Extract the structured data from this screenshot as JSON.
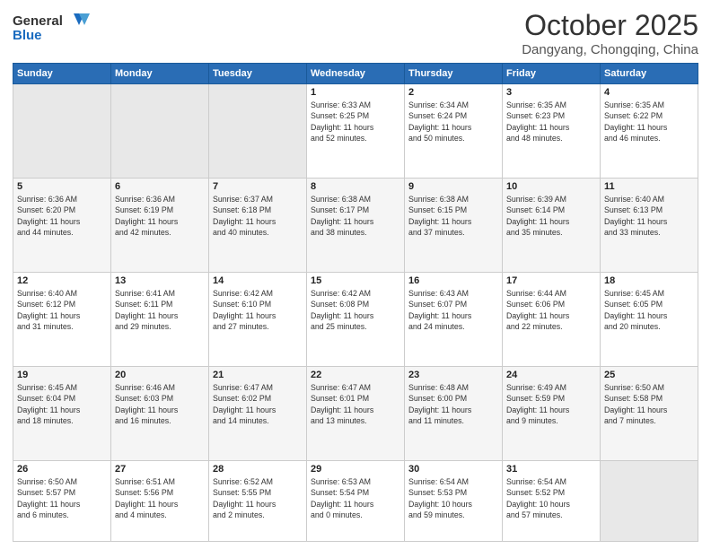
{
  "header": {
    "logo": {
      "general": "General",
      "blue": "Blue"
    },
    "title": "October 2025",
    "location": "Dangyang, Chongqing, China"
  },
  "weekdays": [
    "Sunday",
    "Monday",
    "Tuesday",
    "Wednesday",
    "Thursday",
    "Friday",
    "Saturday"
  ],
  "weeks": [
    {
      "days": [
        {
          "num": "",
          "info": "",
          "empty": true
        },
        {
          "num": "",
          "info": "",
          "empty": true
        },
        {
          "num": "",
          "info": "",
          "empty": true
        },
        {
          "num": "1",
          "info": "Sunrise: 6:33 AM\nSunset: 6:25 PM\nDaylight: 11 hours\nand 52 minutes.",
          "empty": false
        },
        {
          "num": "2",
          "info": "Sunrise: 6:34 AM\nSunset: 6:24 PM\nDaylight: 11 hours\nand 50 minutes.",
          "empty": false
        },
        {
          "num": "3",
          "info": "Sunrise: 6:35 AM\nSunset: 6:23 PM\nDaylight: 11 hours\nand 48 minutes.",
          "empty": false
        },
        {
          "num": "4",
          "info": "Sunrise: 6:35 AM\nSunset: 6:22 PM\nDaylight: 11 hours\nand 46 minutes.",
          "empty": false
        }
      ]
    },
    {
      "days": [
        {
          "num": "5",
          "info": "Sunrise: 6:36 AM\nSunset: 6:20 PM\nDaylight: 11 hours\nand 44 minutes.",
          "empty": false
        },
        {
          "num": "6",
          "info": "Sunrise: 6:36 AM\nSunset: 6:19 PM\nDaylight: 11 hours\nand 42 minutes.",
          "empty": false
        },
        {
          "num": "7",
          "info": "Sunrise: 6:37 AM\nSunset: 6:18 PM\nDaylight: 11 hours\nand 40 minutes.",
          "empty": false
        },
        {
          "num": "8",
          "info": "Sunrise: 6:38 AM\nSunset: 6:17 PM\nDaylight: 11 hours\nand 38 minutes.",
          "empty": false
        },
        {
          "num": "9",
          "info": "Sunrise: 6:38 AM\nSunset: 6:15 PM\nDaylight: 11 hours\nand 37 minutes.",
          "empty": false
        },
        {
          "num": "10",
          "info": "Sunrise: 6:39 AM\nSunset: 6:14 PM\nDaylight: 11 hours\nand 35 minutes.",
          "empty": false
        },
        {
          "num": "11",
          "info": "Sunrise: 6:40 AM\nSunset: 6:13 PM\nDaylight: 11 hours\nand 33 minutes.",
          "empty": false
        }
      ]
    },
    {
      "days": [
        {
          "num": "12",
          "info": "Sunrise: 6:40 AM\nSunset: 6:12 PM\nDaylight: 11 hours\nand 31 minutes.",
          "empty": false
        },
        {
          "num": "13",
          "info": "Sunrise: 6:41 AM\nSunset: 6:11 PM\nDaylight: 11 hours\nand 29 minutes.",
          "empty": false
        },
        {
          "num": "14",
          "info": "Sunrise: 6:42 AM\nSunset: 6:10 PM\nDaylight: 11 hours\nand 27 minutes.",
          "empty": false
        },
        {
          "num": "15",
          "info": "Sunrise: 6:42 AM\nSunset: 6:08 PM\nDaylight: 11 hours\nand 25 minutes.",
          "empty": false
        },
        {
          "num": "16",
          "info": "Sunrise: 6:43 AM\nSunset: 6:07 PM\nDaylight: 11 hours\nand 24 minutes.",
          "empty": false
        },
        {
          "num": "17",
          "info": "Sunrise: 6:44 AM\nSunset: 6:06 PM\nDaylight: 11 hours\nand 22 minutes.",
          "empty": false
        },
        {
          "num": "18",
          "info": "Sunrise: 6:45 AM\nSunset: 6:05 PM\nDaylight: 11 hours\nand 20 minutes.",
          "empty": false
        }
      ]
    },
    {
      "days": [
        {
          "num": "19",
          "info": "Sunrise: 6:45 AM\nSunset: 6:04 PM\nDaylight: 11 hours\nand 18 minutes.",
          "empty": false
        },
        {
          "num": "20",
          "info": "Sunrise: 6:46 AM\nSunset: 6:03 PM\nDaylight: 11 hours\nand 16 minutes.",
          "empty": false
        },
        {
          "num": "21",
          "info": "Sunrise: 6:47 AM\nSunset: 6:02 PM\nDaylight: 11 hours\nand 14 minutes.",
          "empty": false
        },
        {
          "num": "22",
          "info": "Sunrise: 6:47 AM\nSunset: 6:01 PM\nDaylight: 11 hours\nand 13 minutes.",
          "empty": false
        },
        {
          "num": "23",
          "info": "Sunrise: 6:48 AM\nSunset: 6:00 PM\nDaylight: 11 hours\nand 11 minutes.",
          "empty": false
        },
        {
          "num": "24",
          "info": "Sunrise: 6:49 AM\nSunset: 5:59 PM\nDaylight: 11 hours\nand 9 minutes.",
          "empty": false
        },
        {
          "num": "25",
          "info": "Sunrise: 6:50 AM\nSunset: 5:58 PM\nDaylight: 11 hours\nand 7 minutes.",
          "empty": false
        }
      ]
    },
    {
      "days": [
        {
          "num": "26",
          "info": "Sunrise: 6:50 AM\nSunset: 5:57 PM\nDaylight: 11 hours\nand 6 minutes.",
          "empty": false
        },
        {
          "num": "27",
          "info": "Sunrise: 6:51 AM\nSunset: 5:56 PM\nDaylight: 11 hours\nand 4 minutes.",
          "empty": false
        },
        {
          "num": "28",
          "info": "Sunrise: 6:52 AM\nSunset: 5:55 PM\nDaylight: 11 hours\nand 2 minutes.",
          "empty": false
        },
        {
          "num": "29",
          "info": "Sunrise: 6:53 AM\nSunset: 5:54 PM\nDaylight: 11 hours\nand 0 minutes.",
          "empty": false
        },
        {
          "num": "30",
          "info": "Sunrise: 6:54 AM\nSunset: 5:53 PM\nDaylight: 10 hours\nand 59 minutes.",
          "empty": false
        },
        {
          "num": "31",
          "info": "Sunrise: 6:54 AM\nSunset: 5:52 PM\nDaylight: 10 hours\nand 57 minutes.",
          "empty": false
        },
        {
          "num": "",
          "info": "",
          "empty": true
        }
      ]
    }
  ]
}
